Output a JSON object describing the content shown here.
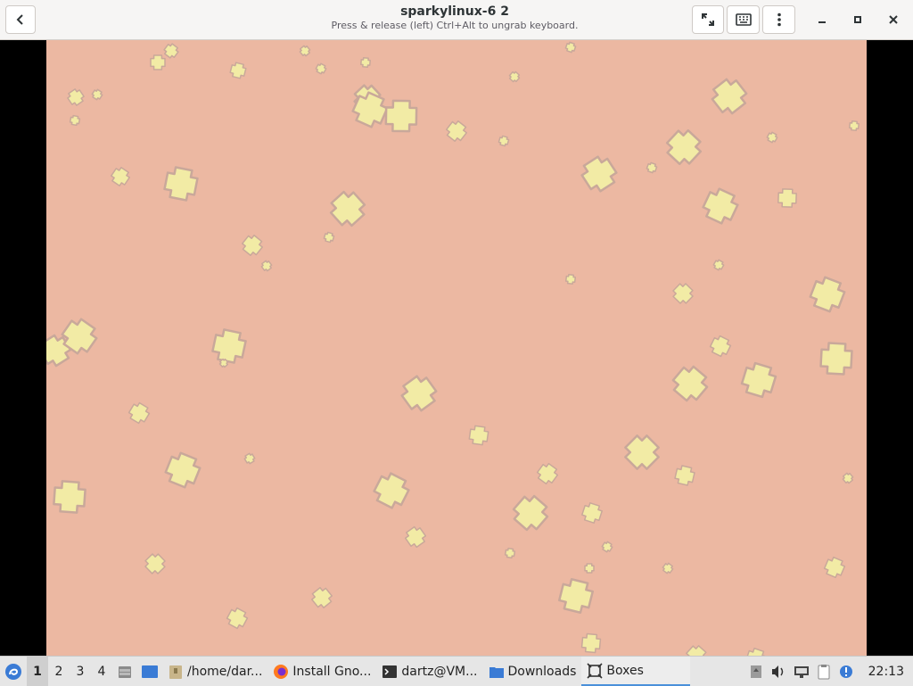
{
  "window": {
    "title": "sparkylinux-6 2",
    "subtitle": "Press & release (left) Ctrl+Alt to ungrab keyboard."
  },
  "header_buttons": {
    "back": "back-icon",
    "fullscreen": "fullscreen-icon",
    "keyboard": "keyboard-icon",
    "menu": "menu-icon",
    "minimize": "minimize-icon",
    "maximize": "maximize-icon",
    "close": "close-icon"
  },
  "colors": {
    "wallpaper": "#ecb8a2",
    "star_fill": "#f2eba5",
    "star_outline": "#c9a89a",
    "active_underline": "#4a90d9"
  },
  "taskbar": {
    "workspaces": [
      "1",
      "2",
      "3",
      "4"
    ],
    "active_workspace": "1",
    "tasks": [
      {
        "label": "/home/dar...",
        "icon": "folder-icon"
      },
      {
        "label": "Install Gno...",
        "icon": "firefox-icon"
      },
      {
        "label": "dartz@VM...",
        "icon": "terminal-icon"
      },
      {
        "label": "Downloads",
        "icon": "folder-icon"
      },
      {
        "label": "Boxes",
        "icon": "boxes-icon",
        "active": true
      }
    ],
    "clock": "22:13"
  }
}
